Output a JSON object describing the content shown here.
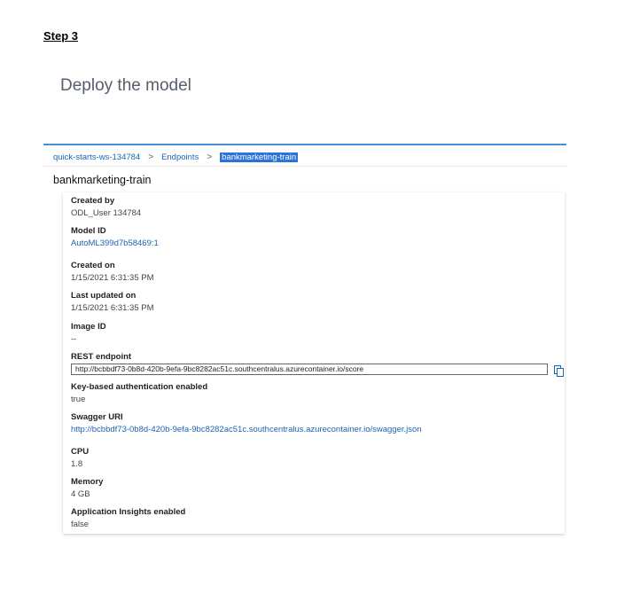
{
  "document": {
    "step_title": "Step 3",
    "section_heading": "Deploy the model"
  },
  "breadcrumb": {
    "items": [
      "quick-starts-ws-134784",
      "Endpoints"
    ],
    "current": "bankmarketing-train",
    "separator": ">"
  },
  "endpoint": {
    "title": "bankmarketing-train",
    "fields": {
      "created_by": {
        "label": "Created by",
        "value": "ODL_User 134784"
      },
      "model_id": {
        "label": "Model ID",
        "value": "AutoML399d7b58469:1"
      },
      "created_on": {
        "label": "Created on",
        "value": "1/15/2021 6:31:35 PM"
      },
      "last_updated_on": {
        "label": "Last updated on",
        "value": "1/15/2021 6:31:35 PM"
      },
      "image_id": {
        "label": "Image ID",
        "value": "--"
      },
      "rest_endpoint": {
        "label": "REST endpoint",
        "value": "http://bcbbdf73-0b8d-420b-9efa-9bc8282ac51c.southcentralus.azurecontainer.io/score"
      },
      "key_auth": {
        "label": "Key-based authentication enabled",
        "value": "true"
      },
      "swagger_uri": {
        "label": "Swagger URI",
        "value": "http://bcbbdf73-0b8d-420b-9efa-9bc8282ac51c.southcentralus.azurecontainer.io/swagger.json"
      },
      "cpu": {
        "label": "CPU",
        "value": "1.8"
      },
      "memory": {
        "label": "Memory",
        "value": "4 GB"
      },
      "app_insights": {
        "label": "Application Insights enabled",
        "value": "false"
      }
    }
  },
  "icons": {
    "copy": "copy-icon"
  },
  "colors": {
    "accent": "#4a8fd6",
    "link": "#1c64b5",
    "selection": "#2a73d9"
  }
}
